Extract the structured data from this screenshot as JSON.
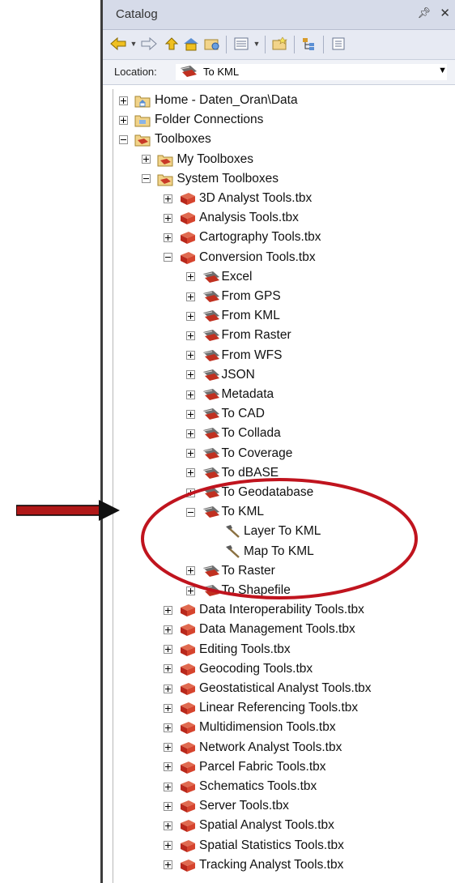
{
  "catalog": {
    "title": "Catalog",
    "pin_icon": "pin-icon",
    "close_icon": "close-icon"
  },
  "toolbar": {
    "icons": [
      "back-icon",
      "back-dropdown-icon",
      "forward-icon",
      "up-one-level-icon",
      "home-icon",
      "connect-folder-icon",
      "toggle-contents-icon",
      "views-dropdown-icon",
      "new-folder-icon",
      "tree-view-icon",
      "options-icon"
    ]
  },
  "location": {
    "label": "Location:",
    "value": "To KML"
  },
  "tree": {
    "items": [
      {
        "label": "Home - Daten_Oran\\Data",
        "level": 0,
        "exp": "plus",
        "icon": "home-folder"
      },
      {
        "label": "Folder Connections",
        "level": 0,
        "exp": "plus",
        "icon": "folder"
      },
      {
        "label": "Toolboxes",
        "level": 0,
        "exp": "minus",
        "icon": "toolbox-folder"
      },
      {
        "label": "My Toolboxes",
        "level": 1,
        "exp": "plus",
        "icon": "toolbox-folder"
      },
      {
        "label": "System Toolboxes",
        "level": 1,
        "exp": "minus",
        "icon": "toolbox-folder"
      },
      {
        "label": "3D Analyst Tools.tbx",
        "level": 2,
        "exp": "plus",
        "icon": "toolbox"
      },
      {
        "label": "Analysis Tools.tbx",
        "level": 2,
        "exp": "plus",
        "icon": "toolbox"
      },
      {
        "label": "Cartography Tools.tbx",
        "level": 2,
        "exp": "plus",
        "icon": "toolbox"
      },
      {
        "label": "Conversion Tools.tbx",
        "level": 2,
        "exp": "minus",
        "icon": "toolbox"
      },
      {
        "label": "Excel",
        "level": 3,
        "exp": "plus",
        "icon": "toolset"
      },
      {
        "label": "From GPS",
        "level": 3,
        "exp": "plus",
        "icon": "toolset"
      },
      {
        "label": "From KML",
        "level": 3,
        "exp": "plus",
        "icon": "toolset"
      },
      {
        "label": "From Raster",
        "level": 3,
        "exp": "plus",
        "icon": "toolset"
      },
      {
        "label": "From WFS",
        "level": 3,
        "exp": "plus",
        "icon": "toolset"
      },
      {
        "label": "JSON",
        "level": 3,
        "exp": "plus",
        "icon": "toolset"
      },
      {
        "label": "Metadata",
        "level": 3,
        "exp": "plus",
        "icon": "toolset"
      },
      {
        "label": "To CAD",
        "level": 3,
        "exp": "plus",
        "icon": "toolset"
      },
      {
        "label": "To Collada",
        "level": 3,
        "exp": "plus",
        "icon": "toolset"
      },
      {
        "label": "To Coverage",
        "level": 3,
        "exp": "plus",
        "icon": "toolset"
      },
      {
        "label": "To dBASE",
        "level": 3,
        "exp": "plus",
        "icon": "toolset"
      },
      {
        "label": "To Geodatabase",
        "level": 3,
        "exp": "plus",
        "icon": "toolset"
      },
      {
        "label": "To KML",
        "level": 3,
        "exp": "minus",
        "icon": "toolset"
      },
      {
        "label": "Layer To KML",
        "level": 4,
        "exp": "none",
        "icon": "tool"
      },
      {
        "label": "Map To KML",
        "level": 4,
        "exp": "none",
        "icon": "tool"
      },
      {
        "label": "To Raster",
        "level": 3,
        "exp": "plus",
        "icon": "toolset"
      },
      {
        "label": "To Shapefile",
        "level": 3,
        "exp": "plus",
        "icon": "toolset"
      },
      {
        "label": "Data Interoperability Tools.tbx",
        "level": 2,
        "exp": "plus",
        "icon": "toolbox"
      },
      {
        "label": "Data Management Tools.tbx",
        "level": 2,
        "exp": "plus",
        "icon": "toolbox"
      },
      {
        "label": "Editing Tools.tbx",
        "level": 2,
        "exp": "plus",
        "icon": "toolbox"
      },
      {
        "label": "Geocoding Tools.tbx",
        "level": 2,
        "exp": "plus",
        "icon": "toolbox"
      },
      {
        "label": "Geostatistical Analyst Tools.tbx",
        "level": 2,
        "exp": "plus",
        "icon": "toolbox"
      },
      {
        "label": "Linear Referencing Tools.tbx",
        "level": 2,
        "exp": "plus",
        "icon": "toolbox"
      },
      {
        "label": "Multidimension Tools.tbx",
        "level": 2,
        "exp": "plus",
        "icon": "toolbox"
      },
      {
        "label": "Network Analyst Tools.tbx",
        "level": 2,
        "exp": "plus",
        "icon": "toolbox"
      },
      {
        "label": "Parcel Fabric Tools.tbx",
        "level": 2,
        "exp": "plus",
        "icon": "toolbox"
      },
      {
        "label": "Schematics Tools.tbx",
        "level": 2,
        "exp": "plus",
        "icon": "toolbox"
      },
      {
        "label": "Server Tools.tbx",
        "level": 2,
        "exp": "plus",
        "icon": "toolbox"
      },
      {
        "label": "Spatial Analyst Tools.tbx",
        "level": 2,
        "exp": "plus",
        "icon": "toolbox"
      },
      {
        "label": "Spatial Statistics Tools.tbx",
        "level": 2,
        "exp": "plus",
        "icon": "toolbox"
      },
      {
        "label": "Tracking Analyst Tools.tbx",
        "level": 2,
        "exp": "plus",
        "icon": "toolbox"
      }
    ]
  },
  "annotation": {
    "arrow_color": "#b01818",
    "circle_color": "#c0141e"
  }
}
